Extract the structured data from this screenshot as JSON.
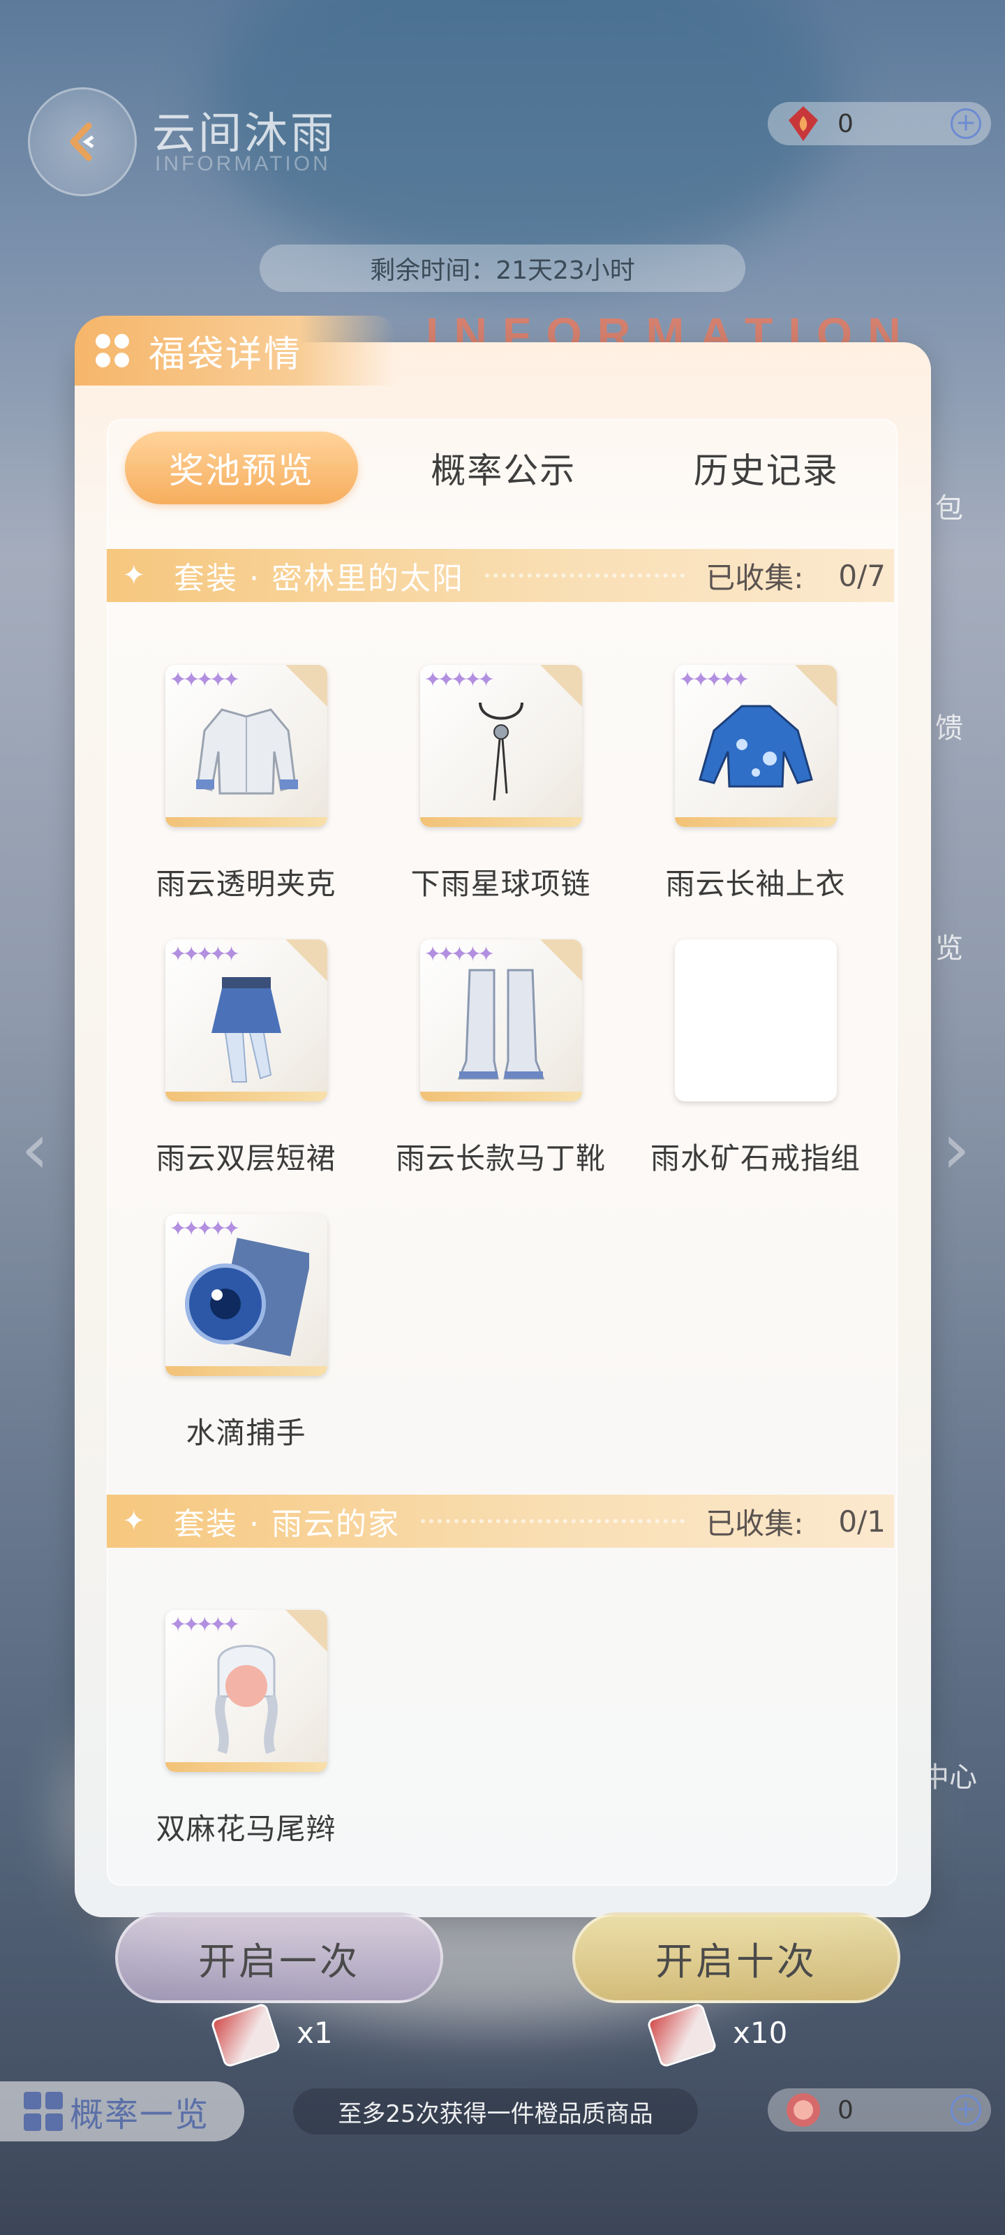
{
  "header": {
    "title": "云间沐雨",
    "subtitle": "INFORMATION",
    "currency_top": {
      "icon": "flame-gem-icon",
      "value": "0"
    },
    "currency_bottom": {
      "icon": "medal-icon",
      "value": "0"
    },
    "timer_label": "剩余时间：21天23小时",
    "decor_text": "INFORMATION"
  },
  "side": {
    "labels": [
      "包",
      "馈",
      "览",
      "中心"
    ]
  },
  "dialog": {
    "title": "福袋详情",
    "tabs": [
      "奖池预览",
      "概率公示",
      "历史记录"
    ],
    "active_tab": 0,
    "sections": [
      {
        "title": "套装 · 密林里的太阳",
        "collected_label": "已收集:",
        "count": "0/7",
        "items": [
          {
            "name": "雨云透明夹克",
            "icon": "jacket-icon"
          },
          {
            "name": "下雨星球项链",
            "icon": "necklace-icon"
          },
          {
            "name": "雨云长袖上衣",
            "icon": "long-sleeve-top-icon"
          },
          {
            "name": "雨云双层短裙",
            "icon": "skirt-icon"
          },
          {
            "name": "雨云长款马丁靴",
            "icon": "boots-icon"
          },
          {
            "name": "雨水矿石戒指组",
            "icon": "blank-card"
          },
          {
            "name": "水滴捕手",
            "icon": "eye-lens-icon"
          }
        ]
      },
      {
        "title": "套装 · 雨云的家",
        "collected_label": "已收集:",
        "count": "0/1",
        "items": [
          {
            "name": "双麻花马尾辫",
            "icon": "braid-hair-icon"
          }
        ]
      }
    ]
  },
  "footer": {
    "open_once": "开启一次",
    "open_ten": "开启十次",
    "cost_once": "x1",
    "cost_ten": "x10",
    "probability_list": "概率一览",
    "guarantee_text": "至多25次获得一件橙品质商品"
  },
  "colors": {
    "accent_orange": "#f6ae5e",
    "tab_active_text": "#ffffff",
    "text_dark": "#3b3b3b",
    "section_bar": "#f6c77e"
  }
}
